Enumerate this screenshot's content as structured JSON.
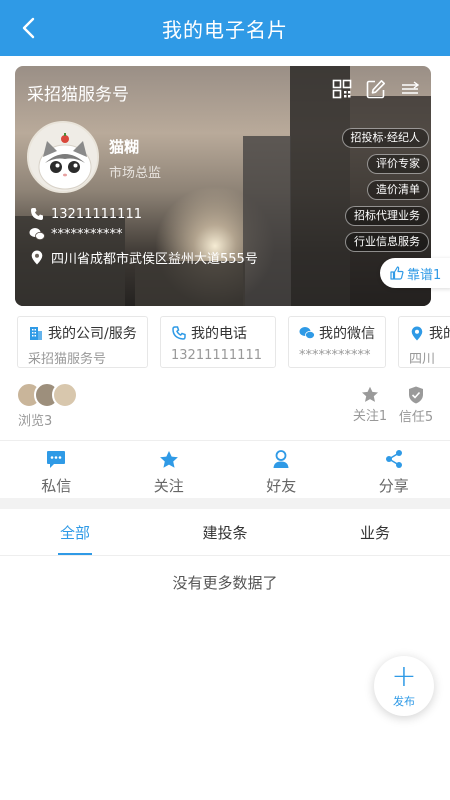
{
  "header": {
    "title": "我的电子名片",
    "back_icon": "chevron-left-icon"
  },
  "card": {
    "company": "采招猫服务号",
    "tools": [
      "qr-code-icon",
      "edit-icon",
      "menu-icon"
    ],
    "name": "猫糊",
    "role": "市场总监",
    "phone": "13211111111",
    "wechat": "***********",
    "address": "四川省成都市武侯区益州大道555号",
    "tags": [
      "招投标·经纪人",
      "评价专家",
      "造价清单",
      "招标代理业务",
      "行业信息服务"
    ]
  },
  "kaopu": {
    "label": "靠谱1"
  },
  "contacts": [
    {
      "label": "我的公司/服务",
      "value": "采招猫服务号",
      "icon": "building-icon"
    },
    {
      "label": "我的电话",
      "value": "13211111111",
      "icon": "phone-icon"
    },
    {
      "label": "我的微信",
      "value": "***********",
      "icon": "wechat-icon"
    },
    {
      "label": "我的地址",
      "value": "四川",
      "icon": "location-icon"
    }
  ],
  "stats": {
    "views": "浏览3",
    "follow": "关注1",
    "trust": "信任5"
  },
  "actions": [
    {
      "label": "私信",
      "icon": "message-icon"
    },
    {
      "label": "关注",
      "icon": "star-icon"
    },
    {
      "label": "好友",
      "icon": "person-icon"
    },
    {
      "label": "分享",
      "icon": "share-icon"
    }
  ],
  "tabs": [
    {
      "label": "全部",
      "active": true
    },
    {
      "label": "建投条",
      "active": false
    },
    {
      "label": "业务",
      "active": false
    }
  ],
  "empty_text": "没有更多数据了",
  "fab": {
    "label": "发布"
  },
  "colors": {
    "primary": "#2f9ae6",
    "muted": "#999999"
  }
}
